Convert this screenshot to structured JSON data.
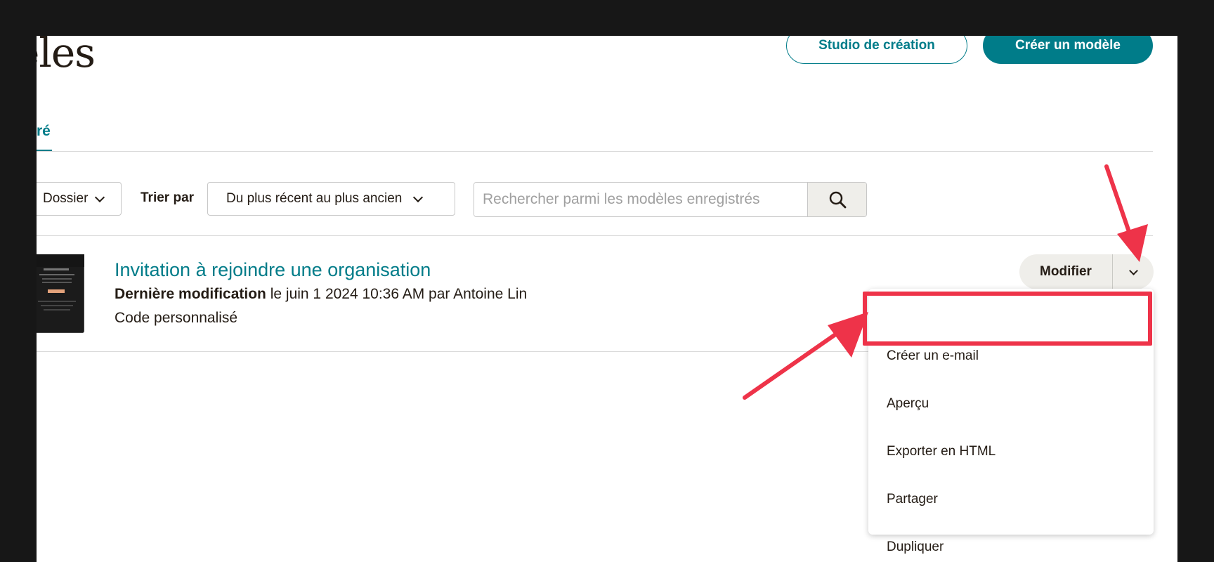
{
  "header": {
    "title": "odèles",
    "studio_button": "Studio de création",
    "create_button": "Créer un modèle"
  },
  "tabs": {
    "active": "ré"
  },
  "filters": {
    "folder_label": "Dossier",
    "sort_label": "Trier par",
    "sort_value": "Du plus récent au plus ancien",
    "search_placeholder": "Rechercher parmi les modèles enregistrés"
  },
  "template": {
    "title": "Invitation à rejoindre une organisation",
    "meta_bold": "Dernière modification",
    "meta_rest": " le juin 1 2024 10:36 AM par Antoine Lin",
    "code_type": "Code personnalisé",
    "edit_button": "Modifier"
  },
  "menu": {
    "items": [
      {
        "label": "Créer un e-mail"
      },
      {
        "label": "Aperçu"
      },
      {
        "label": "Exporter en HTML"
      },
      {
        "label": "Partager"
      },
      {
        "label": "Dupliquer"
      }
    ]
  },
  "colors": {
    "accent": "#007c89",
    "annotation": "#ee3349",
    "text": "#241c15"
  }
}
